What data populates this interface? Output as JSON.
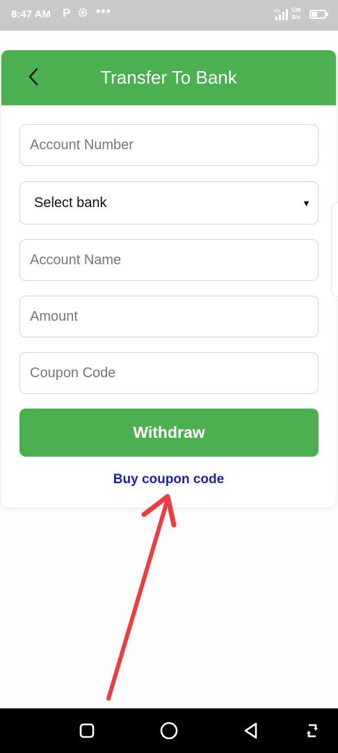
{
  "status_bar": {
    "time": "8:47 AM",
    "app_icon_p": "P",
    "dots": "•••",
    "speed_value": "539",
    "speed_unit": "B/s",
    "signal_tag": "4G"
  },
  "header": {
    "title": "Transfer To Bank",
    "back_icon": "chevron-left-icon"
  },
  "form": {
    "account_number_placeholder": "Account Number",
    "bank_select_value": "Select bank",
    "account_name_placeholder": "Account Name",
    "amount_placeholder": "Amount",
    "coupon_code_placeholder": "Coupon Code",
    "withdraw_label": "Withdraw",
    "buy_coupon_label": "Buy coupon code"
  },
  "colors": {
    "primary": "#4caf50",
    "link": "#1a1fb5",
    "annotation": "#ef3b42",
    "status_bar": "#c9c9c9"
  },
  "nav_bar": {
    "icons": [
      "square-recent-icon",
      "circle-home-icon",
      "triangle-back-icon",
      "rotate-icon"
    ]
  }
}
